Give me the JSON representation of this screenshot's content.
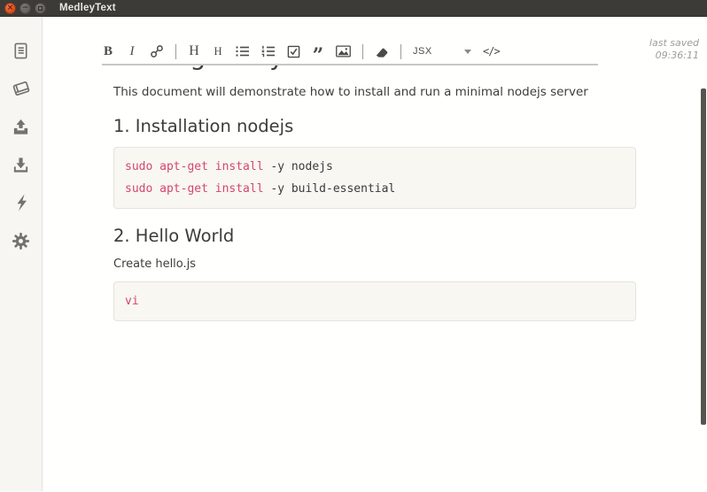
{
  "window": {
    "title": "MedleyText",
    "controls": {
      "close_glyph": "×",
      "minimize_glyph": "−"
    }
  },
  "sidebar": {
    "icons": [
      "document-icon",
      "book-icon",
      "upload-icon",
      "download-icon",
      "lightning-icon",
      "gear-icon"
    ]
  },
  "toolbar": {
    "bold_label": "B",
    "italic_label": "I",
    "heading1_label": "H",
    "heading2_label": "H",
    "quote_glyph": "”",
    "language_value": "JSX",
    "code_label": "</>"
  },
  "status": {
    "last_saved_label": "last saved",
    "last_saved_time": "09:36:11"
  },
  "document": {
    "clipped_title": "Getting ready",
    "intro": "This document will demonstrate how to install and run a minimal nodejs server",
    "sections": [
      {
        "heading": "1. Installation nodejs",
        "code_lines": [
          {
            "highlight": "sudo apt-get install",
            "rest": " -y nodejs"
          },
          {
            "highlight": "sudo apt-get install",
            "rest": " -y build-essential"
          }
        ]
      },
      {
        "heading": "2. Hello World",
        "text": "Create hello.js",
        "code_lines": [
          {
            "highlight": "vi",
            "rest": ""
          }
        ]
      }
    ]
  },
  "colors": {
    "titlebar_bg": "#3c3b37",
    "close_button": "#dd4814",
    "sidebar_bg": "#f7f6f3",
    "code_block_bg": "#f8f7f2",
    "code_highlight": "#d5466b",
    "text": "#3d3d3d"
  }
}
